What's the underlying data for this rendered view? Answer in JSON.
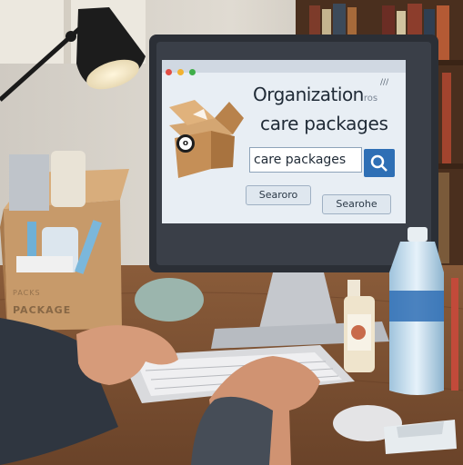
{
  "screen": {
    "heading_line1": "Organization",
    "heading_faint": "ros",
    "heading_line2": "care packages",
    "search_value": "care packages",
    "button_left": "Searoro",
    "button_right": "Searohe",
    "right_tab": "///"
  },
  "box_print": {
    "faint_text": "PACKS",
    "main_text": "PACKAGE"
  },
  "colors": {
    "screen_bg": "#e8eef4",
    "search_button": "#2e6fb5",
    "desk": "#7a5234",
    "wall": "#d9d4cc",
    "cardboard": "#c79a6a"
  },
  "icons": {
    "search_button_icon": "magnifier-icon",
    "box_icon": "open-box-icon"
  }
}
